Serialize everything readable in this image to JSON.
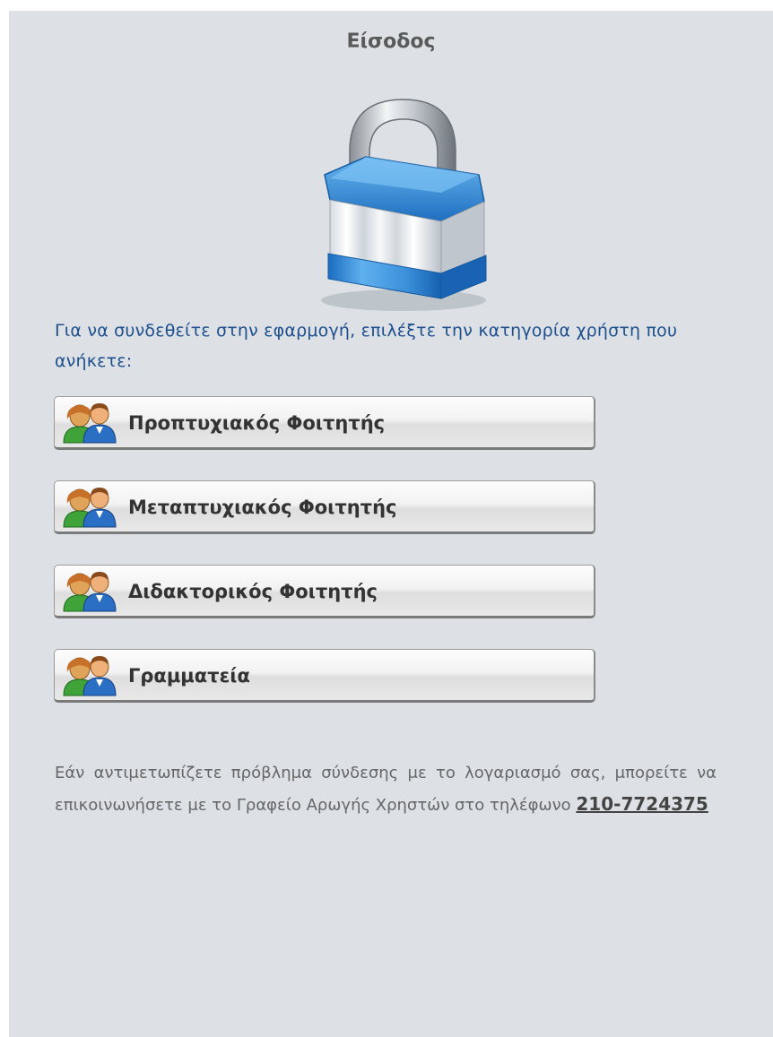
{
  "login": {
    "title": "Είσοδος",
    "intro": "Για να συνδεθείτε στην εφαρμογή, επιλέξτε την κατηγορία χρήστη που ανήκετε:",
    "buttons": [
      {
        "label": "Προπτυχιακός Φοιτητής",
        "icon": "users-icon"
      },
      {
        "label": "Μεταπτυχιακός Φοιτητής",
        "icon": "users-icon"
      },
      {
        "label": "Διδακτορικός Φοιτητής",
        "icon": "users-icon"
      },
      {
        "label": "Γραμματεία",
        "icon": "users-icon"
      }
    ],
    "help_text": "Εάν αντιμετωπίζετε πρόβλημα σύνδεσης με το λογαριασμό σας, μπορείτε να επικοινωνήσετε με το Γραφείο Αρωγής Χρηστών στο τηλέφωνο",
    "phone": "210-7724375"
  },
  "icons": {
    "lock": "padlock-icon"
  },
  "colors": {
    "panel_bg": "#dde1e6",
    "intro_text": "#1d4f8c",
    "lock_blue": "#2f86d6"
  }
}
